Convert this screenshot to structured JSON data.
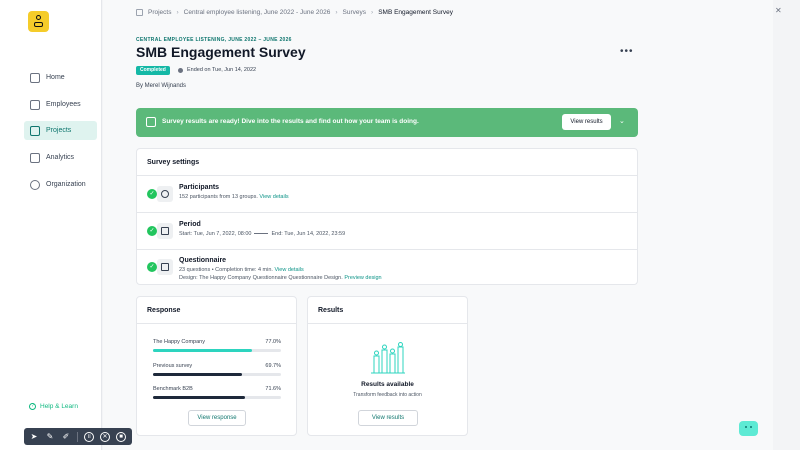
{
  "sidebar": {
    "items": [
      {
        "label": "Home",
        "icon": "home-icon"
      },
      {
        "label": "Employees",
        "icon": "employees-icon"
      },
      {
        "label": "Projects",
        "icon": "projects-icon",
        "active": true
      },
      {
        "label": "Analytics",
        "icon": "analytics-icon"
      },
      {
        "label": "Organization",
        "icon": "organization-icon"
      }
    ],
    "help_label": "Help & Learn"
  },
  "breadcrumb": [
    "Projects",
    "Central employee listening, June 2022 - June 2026",
    "Surveys",
    "SMB Engagement Survey"
  ],
  "header": {
    "eyebrow": "CENTRAL EMPLOYEE LISTENING, JUNE 2022 – JUNE 2026",
    "title": "SMB Engagement Survey",
    "status": "Completed",
    "ended": "Ended on Tue, Jun 14, 2022",
    "byline": "By Merel Wijnands"
  },
  "banner": {
    "message": "Survey results are ready! Dive into the results and find out how your team is doing.",
    "button": "View results"
  },
  "settings": {
    "title": "Survey settings",
    "participants": {
      "label": "Participants",
      "text": "152 participants from 13 groups.",
      "link": "View details"
    },
    "period": {
      "label": "Period",
      "start": "Start: Tue, Jun 7, 2022, 08:00",
      "end": "End: Tue, Jun 14, 2022, 23:59"
    },
    "questionnaire": {
      "label": "Questionnaire",
      "text": "23 questions • Completion time: 4 min.",
      "link": "View details",
      "design": "Design: The Happy Company Questionnaire Questionnaire Design.",
      "design_link": "Preview design"
    }
  },
  "response": {
    "title": "Response",
    "items": [
      {
        "name": "The Happy Company",
        "percent": "77.0%",
        "value": 0.77,
        "color": "#2dd4bf"
      },
      {
        "name": "Previous survey",
        "percent": "69.7%",
        "value": 0.697,
        "color": "#1e293b"
      },
      {
        "name": "Benchmark B2B",
        "percent": "71.6%",
        "value": 0.716,
        "color": "#1e293b"
      }
    ],
    "button": "View response"
  },
  "results": {
    "title": "Results",
    "heading": "Results available",
    "sub": "Transform feedback into action",
    "button": "View results"
  },
  "colors": {
    "accent": "#14b8a6",
    "banner": "#5bb97a",
    "brand": "#f5cc2a"
  }
}
